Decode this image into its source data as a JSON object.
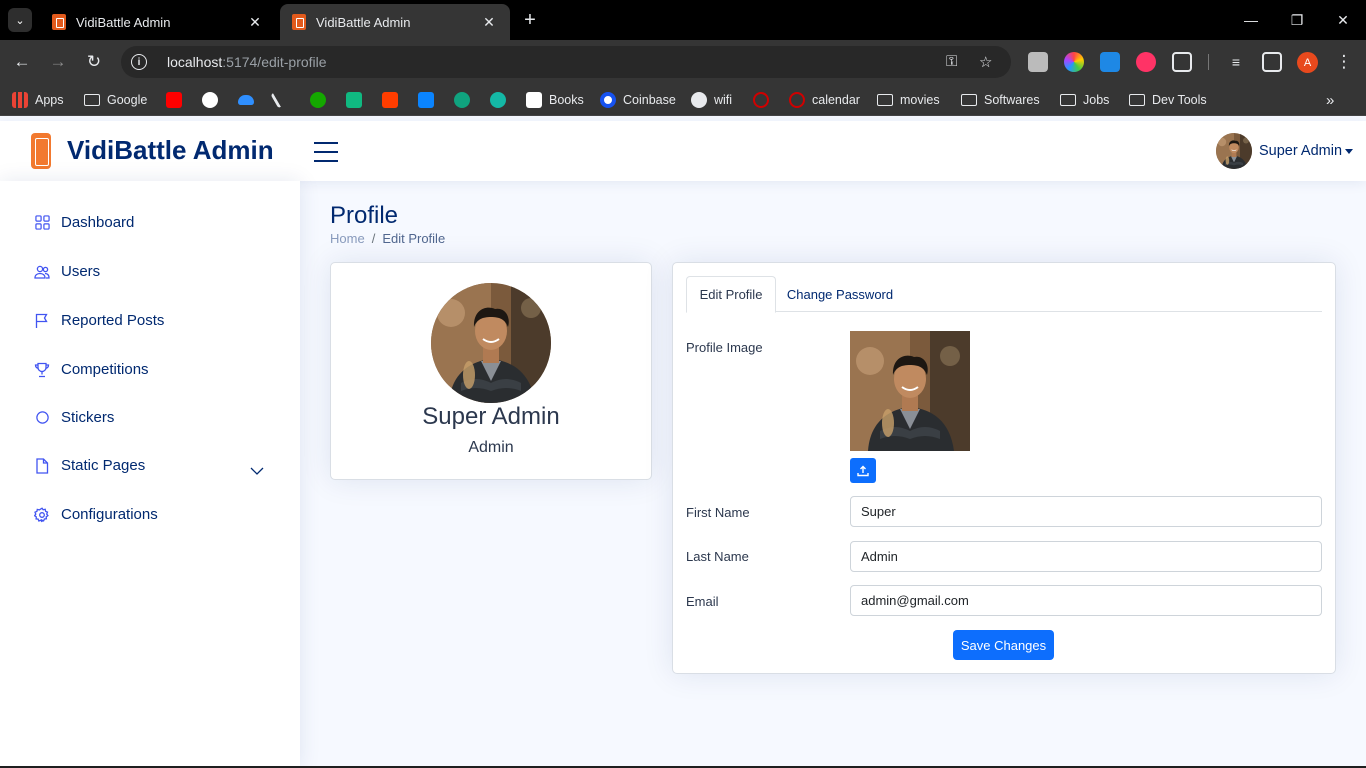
{
  "browser": {
    "tabs": [
      {
        "title": "VidiBattle Admin",
        "active": false
      },
      {
        "title": "VidiBattle Admin",
        "active": true
      }
    ],
    "url_host": "localhost",
    "url_path": ":5174/edit-profile",
    "profile_initial": "A",
    "bookmarks": [
      {
        "label": "Apps",
        "kind": "apps"
      },
      {
        "label": "Google",
        "kind": "folder"
      },
      {
        "label": "",
        "kind": "youtube-icon",
        "color": "#ff0000"
      },
      {
        "label": "",
        "kind": "github-icon",
        "color": "#ffffff"
      },
      {
        "label": "",
        "kind": "onedrive-icon",
        "color": "#2f8fff"
      },
      {
        "label": "",
        "kind": "pen-icon",
        "color": "#e8eaed"
      },
      {
        "label": "",
        "kind": "upwork-icon",
        "color": "#14a800"
      },
      {
        "label": "",
        "kind": "d-icon",
        "color": "#10b981"
      },
      {
        "label": "",
        "kind": "p-icon",
        "color": "#ff3d00"
      },
      {
        "label": "",
        "kind": "vscode-icon",
        "color": "#0a84ff"
      },
      {
        "label": "",
        "kind": "chatgpt-icon",
        "color": "#10a37f"
      },
      {
        "label": "",
        "kind": "es-icon",
        "color": "#14b8a6"
      },
      {
        "label": "Books",
        "kind": "books"
      },
      {
        "label": "Coinbase",
        "kind": "coinbase"
      },
      {
        "label": "wifi",
        "kind": "wifi"
      },
      {
        "label": "",
        "kind": "red-icon",
        "color": "#d00000"
      },
      {
        "label": "calendar",
        "kind": "calendar"
      },
      {
        "label": "movies",
        "kind": "folder"
      },
      {
        "label": "Softwares",
        "kind": "folder"
      },
      {
        "label": "Jobs",
        "kind": "folder"
      },
      {
        "label": "Dev Tools",
        "kind": "folder"
      }
    ]
  },
  "header": {
    "brand": "VidiBattle Admin",
    "user_name": "Super Admin"
  },
  "sidebar": {
    "items": [
      {
        "label": "Dashboard",
        "icon": "grid-icon"
      },
      {
        "label": "Users",
        "icon": "people-icon"
      },
      {
        "label": "Reported Posts",
        "icon": "flag-icon"
      },
      {
        "label": "Competitions",
        "icon": "trophy-icon"
      },
      {
        "label": "Stickers",
        "icon": "circle-icon"
      },
      {
        "label": "Static Pages",
        "icon": "file-icon"
      },
      {
        "label": "Configurations",
        "icon": "gear-icon"
      }
    ]
  },
  "page": {
    "title": "Profile",
    "breadcrumb_home": "Home",
    "breadcrumb_sep": "/",
    "breadcrumb_current": "Edit Profile"
  },
  "profile_card": {
    "name": "Super Admin",
    "role": "Admin"
  },
  "form": {
    "tab_edit": "Edit Profile",
    "tab_password": "Change Password",
    "profile_image_label": "Profile Image",
    "first_name_label": "First Name",
    "first_name_value": "Super",
    "last_name_label": "Last Name",
    "last_name_value": "Admin",
    "email_label": "Email",
    "email_value": "admin@gmail.com",
    "save_label": "Save Changes"
  },
  "colors": {
    "primary": "#0d6efd",
    "navy": "#012970",
    "brand_orange": "#f2792f"
  }
}
